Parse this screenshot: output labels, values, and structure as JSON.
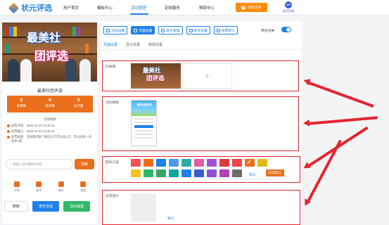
{
  "brand": {
    "name": "状元评选"
  },
  "nav": {
    "items": [
      {
        "label": "用户首页"
      },
      {
        "label": "模板中心"
      },
      {
        "label": "活动管理"
      },
      {
        "label": "定制服务"
      },
      {
        "label": "帮助中心"
      }
    ],
    "create_label": "创建活动",
    "vip_label": "会员升级",
    "vip_badge": "VIP"
  },
  "preview": {
    "poster_line1": "最美社",
    "poster_line2": "团评选",
    "contest_name": "最美社团评选",
    "stats": [
      {
        "value": "0",
        "label": "总票数"
      },
      {
        "value": "6",
        "label": "选手数"
      },
      {
        "value": "0",
        "label": "访问量"
      }
    ],
    "rules_title": "活动规则",
    "rules": [
      "投票开始：2025-01-16 13:45:16",
      "投票截止：2025-01-22 13:45:16",
      "投票规则：活动期间每个微信号只可以投1次，可以投给一名选手1票"
    ],
    "search_placeholder": "请输入选手编号/名称",
    "search_button": "搜索",
    "tabbar": [
      {
        "label": "介绍"
      },
      {
        "label": "选手"
      },
      {
        "label": "排行"
      },
      {
        "label": "奖品"
      }
    ],
    "buttons": {
      "refresh": "刷新",
      "publish": "发布活动",
      "poster": "活动海报"
    }
  },
  "toolbar": {
    "tools": [
      {
        "label": "活动设置",
        "active": false
      },
      {
        "label": "页面设置",
        "active": true
      },
      {
        "label": "选手管理",
        "active": false
      },
      {
        "label": "现场设置",
        "active": false
      },
      {
        "label": "投票统计",
        "active": false
      }
    ],
    "preview_toggle_label": "预览效果",
    "preview_toggle_on": true
  },
  "subtabs": [
    "页面设置",
    "显示设置",
    "底部设置"
  ],
  "sections": {
    "cover": {
      "label": "轮播图",
      "thumb_line1": "最美社",
      "thumb_line2": "团评选",
      "add_symbol": "+"
    },
    "template": {
      "label": "活动模板",
      "phone_title": "最美社团评选"
    },
    "color": {
      "label": "配色方案",
      "colors": [
        "#ef5555",
        "#e96f1c",
        "#1f80e6",
        "#4d9ae8",
        "#2fa8a0",
        "#e05aa5",
        "#a14fd6",
        "#dd3b3b",
        "#ef4545",
        "#e96f1c",
        "#e0b81c",
        "#f0c41e",
        "#2fb865",
        "#3aa56b",
        "#14a6a0",
        "#1f80e6",
        "#3a5ccf",
        "#8e4fd6",
        "#b43fb4",
        "#6b6b6b"
      ],
      "selected_index": 9,
      "default_label": "默认",
      "restore_label": "恢复默认"
    },
    "background": {
      "label": "背景图片",
      "default_label": "默认"
    }
  }
}
